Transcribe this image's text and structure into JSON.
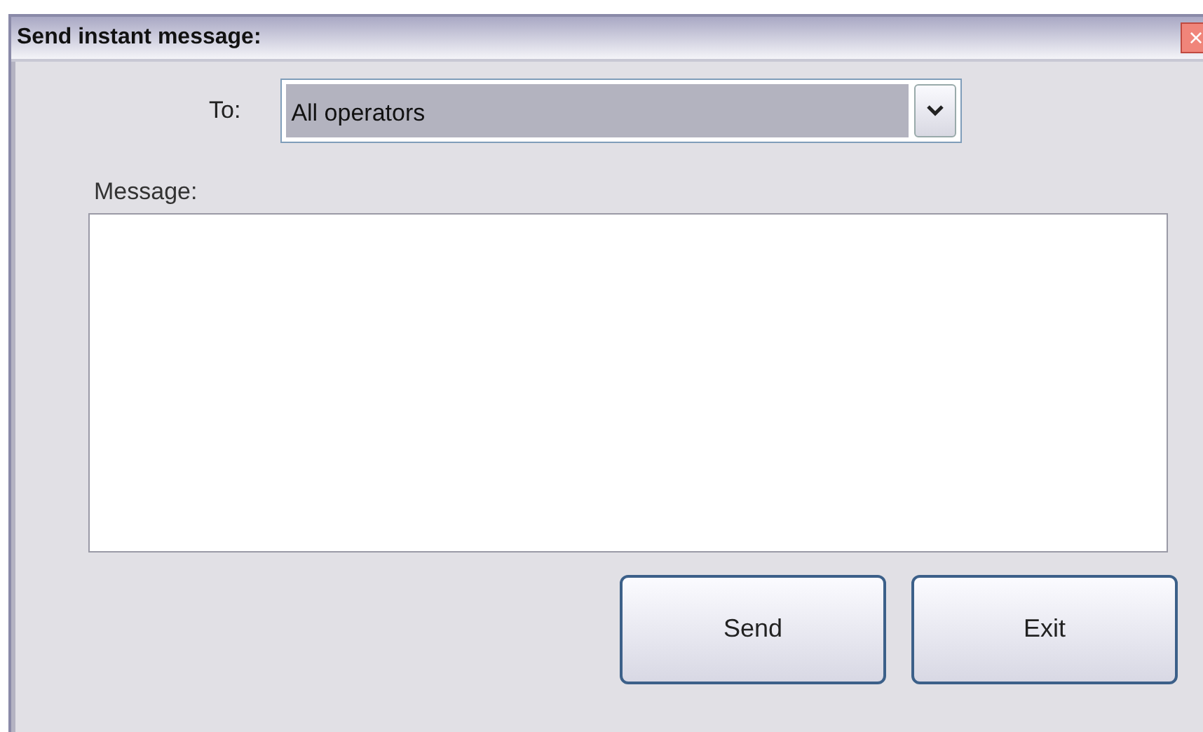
{
  "window": {
    "title": "Send instant message:",
    "close": "×"
  },
  "to": {
    "label": "To:",
    "value": "All operators"
  },
  "message": {
    "label": "Message:"
  },
  "buttons": [
    "Send",
    "Exit"
  ]
}
